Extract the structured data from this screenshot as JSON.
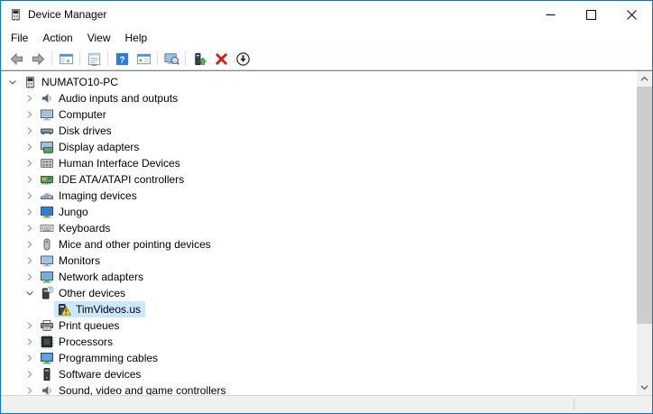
{
  "window": {
    "title": "Device Manager"
  },
  "title_bar": {
    "controls": [
      {
        "name": "minimize",
        "icon": "minimize-icon"
      },
      {
        "name": "maximize",
        "icon": "maximize-icon"
      },
      {
        "name": "close",
        "icon": "close-icon"
      }
    ]
  },
  "menu": {
    "items": [
      "File",
      "Action",
      "View",
      "Help"
    ]
  },
  "toolbar": {
    "buttons": [
      {
        "name": "back",
        "icon": "toolbar-back"
      },
      {
        "name": "forward",
        "icon": "toolbar-forward"
      },
      {
        "sep": true
      },
      {
        "name": "show-console-tree",
        "icon": "toolbar-console-tree"
      },
      {
        "sep": true
      },
      {
        "name": "properties",
        "icon": "toolbar-properties"
      },
      {
        "sep": true
      },
      {
        "name": "help",
        "icon": "toolbar-help"
      },
      {
        "name": "show-action-pane",
        "icon": "toolbar-action-pane"
      },
      {
        "sep": true
      },
      {
        "name": "scan-hardware-changes",
        "icon": "toolbar-scan"
      },
      {
        "sep": true
      },
      {
        "name": "update-driver",
        "icon": "toolbar-update-driver"
      },
      {
        "name": "uninstall-device",
        "icon": "toolbar-uninstall"
      },
      {
        "name": "disable-device",
        "icon": "toolbar-disable"
      }
    ]
  },
  "tree": {
    "items": [
      {
        "label": "NUMATO10-PC",
        "level": 0,
        "state": "expanded",
        "icon": "computer-device",
        "selected": false
      },
      {
        "label": "Audio inputs and outputs",
        "level": 1,
        "state": "collapsed",
        "icon": "audio-device",
        "selected": false
      },
      {
        "label": "Computer",
        "level": 1,
        "state": "collapsed",
        "icon": "computer-monitor",
        "selected": false
      },
      {
        "label": "Disk drives",
        "level": 1,
        "state": "collapsed",
        "icon": "disk-drive",
        "selected": false
      },
      {
        "label": "Display adapters",
        "level": 1,
        "state": "collapsed",
        "icon": "display-adapter",
        "selected": false
      },
      {
        "label": "Human Interface Devices",
        "level": 1,
        "state": "collapsed",
        "icon": "hid-device",
        "selected": false
      },
      {
        "label": "IDE ATA/ATAPI controllers",
        "level": 1,
        "state": "collapsed",
        "icon": "ide-controller",
        "selected": false
      },
      {
        "label": "Imaging devices",
        "level": 1,
        "state": "collapsed",
        "icon": "imaging-device",
        "selected": false
      },
      {
        "label": "Jungo",
        "level": 1,
        "state": "collapsed",
        "icon": "jungo-device",
        "selected": false
      },
      {
        "label": "Keyboards",
        "level": 1,
        "state": "collapsed",
        "icon": "keyboard-device",
        "selected": false
      },
      {
        "label": "Mice and other pointing devices",
        "level": 1,
        "state": "collapsed",
        "icon": "mouse-device",
        "selected": false
      },
      {
        "label": "Monitors",
        "level": 1,
        "state": "collapsed",
        "icon": "monitor-device",
        "selected": false
      },
      {
        "label": "Network adapters",
        "level": 1,
        "state": "collapsed",
        "icon": "network-adapter",
        "selected": false
      },
      {
        "label": "Other devices",
        "level": 1,
        "state": "expanded",
        "icon": "unknown-device",
        "selected": false
      },
      {
        "label": "TimVideos.us",
        "level": 2,
        "state": "leaf",
        "icon": "warning-device",
        "selected": true
      },
      {
        "label": "Print queues",
        "level": 1,
        "state": "collapsed",
        "icon": "printer-device",
        "selected": false
      },
      {
        "label": "Processors",
        "level": 1,
        "state": "collapsed",
        "icon": "processor-device",
        "selected": false
      },
      {
        "label": "Programming cables",
        "level": 1,
        "state": "collapsed",
        "icon": "programming-cable",
        "selected": false
      },
      {
        "label": "Software devices",
        "level": 1,
        "state": "collapsed",
        "icon": "software-device",
        "selected": false
      },
      {
        "label": "Sound, video and game controllers",
        "level": 1,
        "state": "collapsed",
        "icon": "audio-device",
        "selected": false,
        "clipped": true
      }
    ]
  },
  "status_bar": {
    "text": ""
  },
  "colors": {
    "window_border": "#0078d7",
    "selection_bg": "#cce8ff",
    "statusbar_bg": "#f0f0f0",
    "scrollbar_thumb": "#cdcdcd",
    "error_red": "#cc1f1f",
    "warning_yellow": "#fdd835",
    "help_blue": "#2f7bd6"
  }
}
